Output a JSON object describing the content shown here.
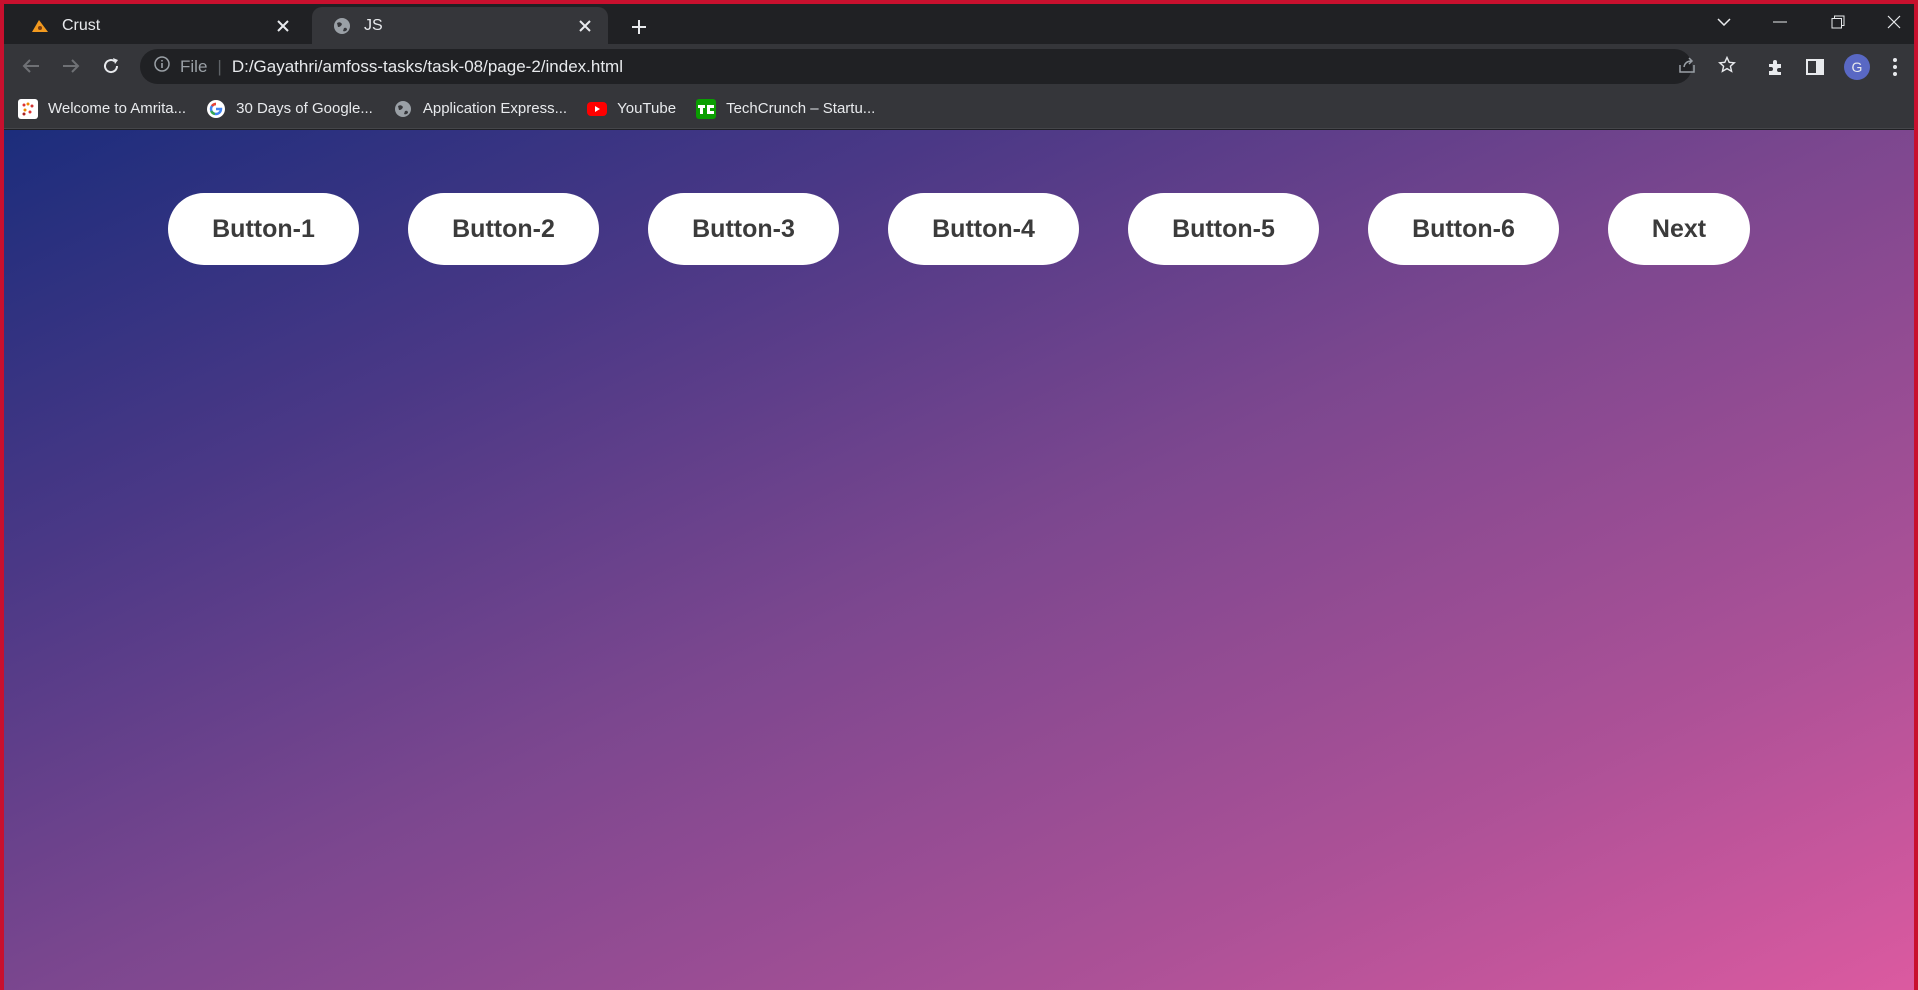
{
  "tabs": [
    {
      "title": "Crust",
      "icon": "crust-favicon"
    },
    {
      "title": "JS",
      "icon": "globe-icon"
    }
  ],
  "toolbar": {
    "scheme_label": "File",
    "url": "D:/Gayathri/amfoss-tasks/task-08/page-2/index.html",
    "profile_initial": "G"
  },
  "bookmarks": [
    {
      "label": "Welcome to Amrita...",
      "icon": "amrita-icon"
    },
    {
      "label": "30 Days of Google...",
      "icon": "google-icon"
    },
    {
      "label": "Application Express...",
      "icon": "globe-icon"
    },
    {
      "label": "YouTube",
      "icon": "youtube-icon"
    },
    {
      "label": "TechCrunch – Startu...",
      "icon": "techcrunch-icon"
    }
  ],
  "page": {
    "buttons": [
      "Button-1",
      "Button-2",
      "Button-3",
      "Button-4",
      "Button-5",
      "Button-6"
    ],
    "next_label": "Next"
  },
  "colors": {
    "gradient_start": "#1c2d7c",
    "gradient_end": "#dc5aa0",
    "window_border": "#c8102e",
    "button_text": "#3b3b3b"
  }
}
